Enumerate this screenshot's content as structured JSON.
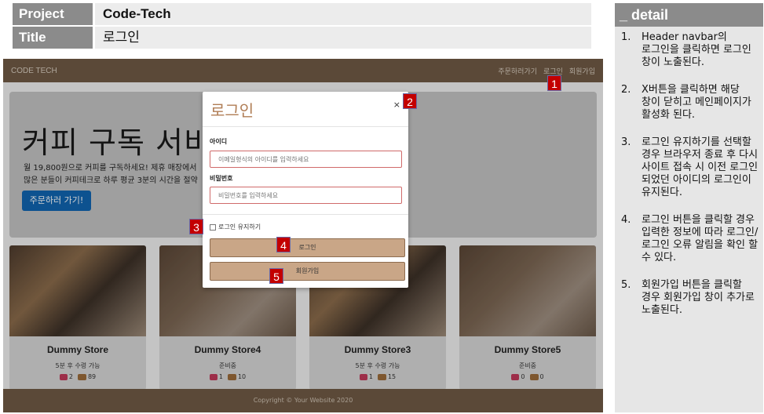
{
  "meta": {
    "project_label": "Project",
    "project_value": "Code-Tech",
    "title_label": "Title",
    "title_value": "로그인"
  },
  "detail": {
    "heading": "_ detail",
    "items": [
      {
        "num": "1.",
        "text": "Header navbar의 로그인을 클릭하면 로그인 창이 노출된다."
      },
      {
        "num": "2.",
        "text": "X버튼을 클릭하면 해당 창이 닫히고 메인페이지가 활성화 된다."
      },
      {
        "num": "3.",
        "text": "로그인 유지하기를 선택할 경우 브라우저 종료 후 다시 사이트 접속 시 이전 로그인 되었던 아이디의 로그인이 유지된다."
      },
      {
        "num": "4.",
        "text": "로그인 버튼을 클릭할 경우 입력한 정보에 따라 로그인/ 로그인 오류 알림을 확인 할 수 있다."
      },
      {
        "num": "5.",
        "text": "회원가입 버튼을 클릭할 경우 회원가입 창이 추가로 노출된다."
      }
    ]
  },
  "app": {
    "brand": "CODE TECH",
    "nav": [
      "주문하러가기",
      "로그인",
      "회원가입"
    ],
    "hero": {
      "title": "커피 구독 서비스",
      "sub1": "월 19,800원으로 커피를 구독하세요! 제휴 매장에서",
      "sub2": "많은 분들이 커피테크로 하루 평균 3분의 시간을 절약",
      "button": "주문하러 가기!"
    },
    "cards": [
      {
        "name": "Dummy Store",
        "status": "5분 후 수령 가능",
        "likes": "2",
        "orders": "89"
      },
      {
        "name": "Dummy Store4",
        "status": "준비중",
        "likes": "1",
        "orders": "10"
      },
      {
        "name": "Dummy Store3",
        "status": "5분 후 수령 가능",
        "likes": "1",
        "orders": "15"
      },
      {
        "name": "Dummy Store5",
        "status": "준비중",
        "likes": "0",
        "orders": "0"
      }
    ],
    "footer": "Copyright © Your Website 2020"
  },
  "modal": {
    "title": "로그인",
    "close": "×",
    "id_label": "아이디",
    "id_placeholder": "이메일형식의 아이디를 입력하세요",
    "pw_label": "비밀번호",
    "pw_placeholder": "비밀번호를 입력하세요",
    "remember": "로그인 유지하기",
    "login_button": "로그인",
    "signup_button": "회원가입"
  },
  "markers": [
    "1",
    "2",
    "3",
    "4",
    "5"
  ],
  "colors": {
    "navbar": "#6f5a45",
    "accent_button": "#c9a687",
    "marker_red": "#c30000",
    "hero_button": "#1064b0"
  }
}
